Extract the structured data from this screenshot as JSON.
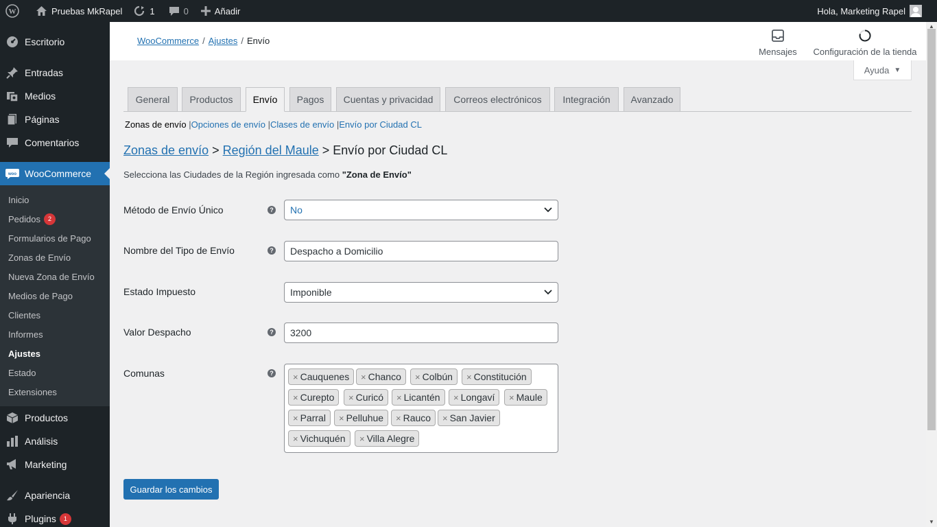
{
  "adminbar": {
    "site_name": "Pruebas MkRapel",
    "updates_count": "1",
    "comments_count": "0",
    "add_new_label": "Añadir",
    "greeting": "Hola, Marketing Rapel"
  },
  "sidebar": {
    "items": [
      {
        "label": "Escritorio",
        "icon": "dashboard-icon"
      },
      {
        "label": "Entradas",
        "icon": "pin-icon"
      },
      {
        "label": "Medios",
        "icon": "media-icon"
      },
      {
        "label": "Páginas",
        "icon": "pages-icon"
      },
      {
        "label": "Comentarios",
        "icon": "comment-icon"
      },
      {
        "label": "WooCommerce",
        "icon": "woo-icon"
      }
    ],
    "submenu": [
      {
        "label": "Inicio"
      },
      {
        "label": "Pedidos",
        "badge": "2"
      },
      {
        "label": "Formularios de Pago"
      },
      {
        "label": "Zonas de Envío"
      },
      {
        "label": "Nueva Zona de Envío"
      },
      {
        "label": "Medios de Pago"
      },
      {
        "label": "Clientes"
      },
      {
        "label": "Informes"
      },
      {
        "label": "Ajustes"
      },
      {
        "label": "Estado"
      },
      {
        "label": "Extensiones"
      }
    ],
    "bottom_items": [
      {
        "label": "Productos",
        "icon": "box-icon"
      },
      {
        "label": "Análisis",
        "icon": "chart-icon"
      },
      {
        "label": "Marketing",
        "icon": "megaphone-icon"
      },
      {
        "label": "Apariencia",
        "icon": "brush-icon"
      },
      {
        "label": "Plugins",
        "icon": "plug-icon",
        "badge": "1"
      }
    ]
  },
  "header": {
    "breadcrumb": [
      "WooCommerce",
      "Ajustes",
      "Envío"
    ],
    "messages_label": "Mensajes",
    "store_setup_label": "Configuración de la tienda"
  },
  "help_label": "Ayuda",
  "tabs": [
    "General",
    "Productos",
    "Envío",
    "Pagos",
    "Cuentas y privacidad",
    "Correos electrónicos",
    "Integración",
    "Avanzado"
  ],
  "active_tab": "Envío",
  "subnav": {
    "current": "Zonas de envío",
    "links": [
      "Opciones de envío",
      "Clases de envío",
      "Envío por Ciudad CL"
    ]
  },
  "heading": {
    "link1": "Zonas de envío",
    "link2": "Región del Maule",
    "current": "Envío por Ciudad CL",
    "sep": ">"
  },
  "intro": {
    "text": "Selecciona las Ciudades de la Región ingresada como ",
    "bold": "\"Zona de Envío\""
  },
  "form": {
    "metodo_label": "Método de Envío Único",
    "metodo_value": "No",
    "nombre_label": "Nombre del Tipo de Envío",
    "nombre_value": "Despacho a Domicilio",
    "estado_label": "Estado Impuesto",
    "estado_value": "Imponible",
    "valor_label": "Valor Despacho",
    "valor_value": "3200",
    "comunas_label": "Comunas",
    "comunas": [
      "Cauquenes",
      "Chanco",
      "Colbún",
      "Constitución",
      "Curepto",
      "Curicó",
      "Licantén",
      "Longaví",
      "Maule",
      "Parral",
      "Pelluhue",
      "Rauco",
      "San Javier",
      "Vichuquén",
      "Villa Alegre"
    ]
  },
  "save_label": "Guardar los cambios",
  "colors": {
    "accent": "#2271b1",
    "sidebar": "#1d2327",
    "badge": "#d63638"
  }
}
